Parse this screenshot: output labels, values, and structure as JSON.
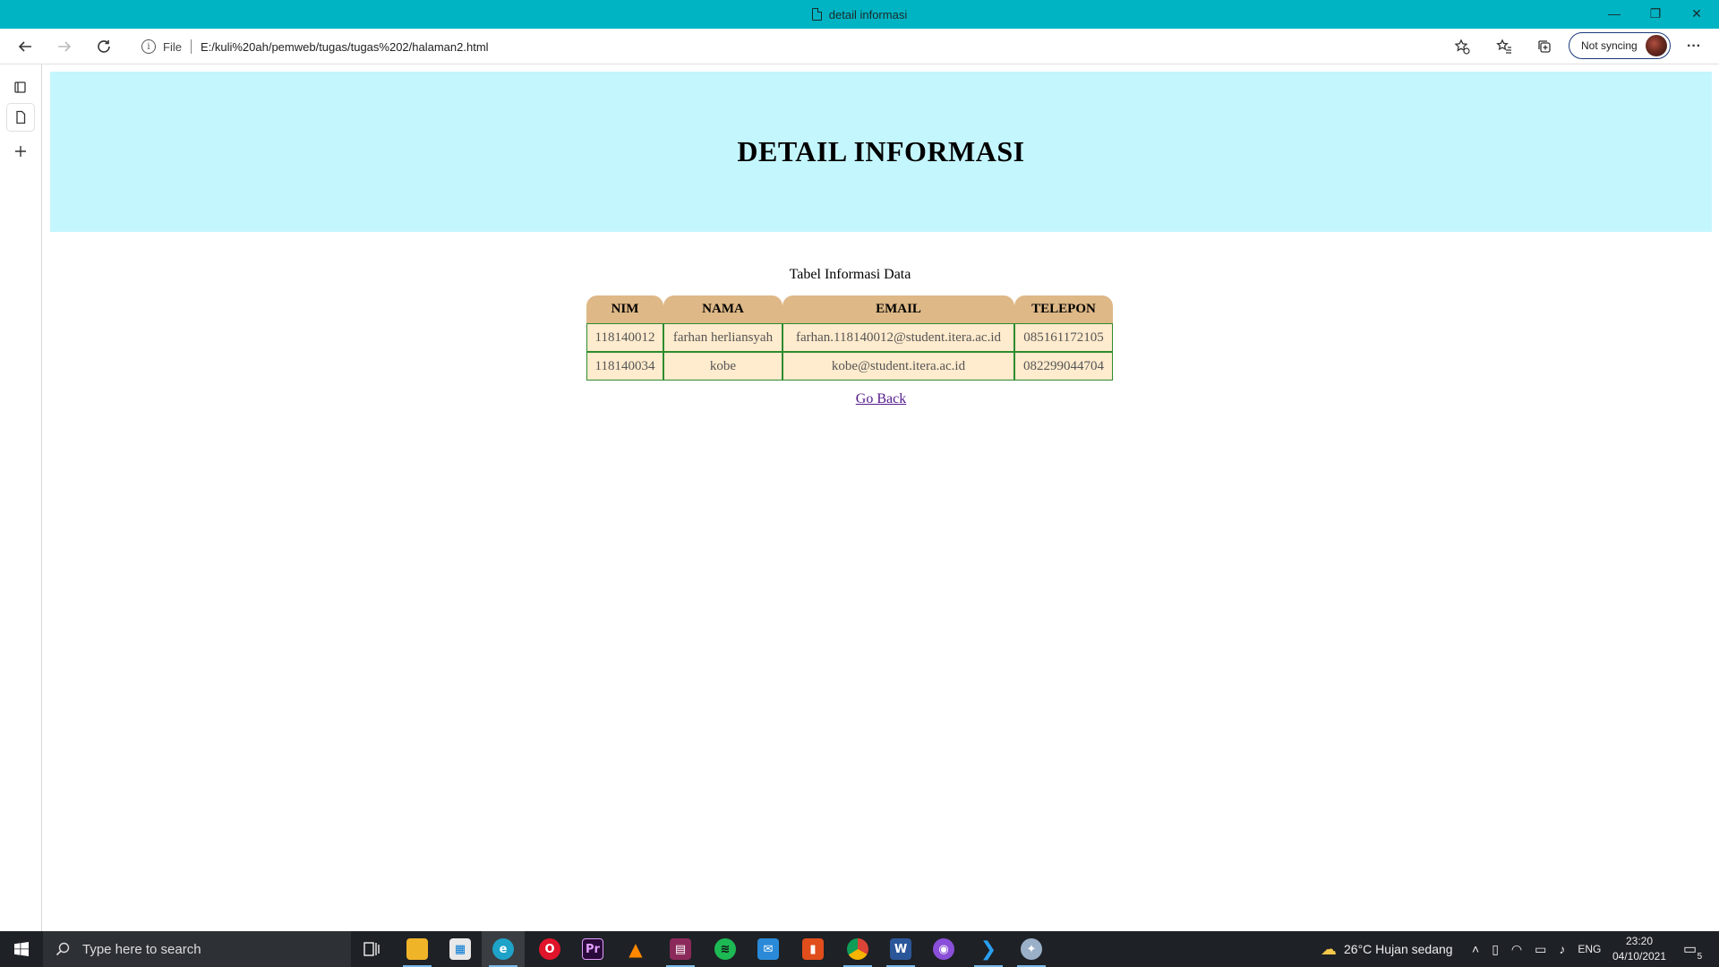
{
  "window": {
    "title": "detail informasi",
    "controls": {
      "minimize": "—",
      "restore": "❐",
      "close": "✕"
    }
  },
  "toolbar": {
    "scheme": "File",
    "url": "E:/kuli%20ah/pemweb/tugas/tugas%202/halaman2.html",
    "sync_label": "Not syncing",
    "more": "···"
  },
  "page": {
    "heading": "DETAIL INFORMASI",
    "caption": "Tabel Informasi Data",
    "table": {
      "headers": [
        "NIM",
        "NAMA",
        "EMAIL",
        "TELEPON"
      ],
      "rows": [
        [
          "118140012",
          "farhan herliansyah",
          "farhan.118140012@student.itera.ac.id",
          "085161172105"
        ],
        [
          "118140034",
          "kobe",
          "kobe@student.itera.ac.id",
          "082299044704"
        ]
      ]
    },
    "link_text": "Go Back",
    "colors": {
      "banner": "#c4f6fd",
      "header_cell": "#deb887",
      "body_cell": "#ffebcd",
      "cell_border": "#2e8b2e"
    }
  },
  "taskbar": {
    "search_placeholder": "Type here to search",
    "apps": [
      "task-view",
      "file-explorer",
      "microsoft-store",
      "edge",
      "opera",
      "premiere-pro",
      "vlc",
      "winrar",
      "spotify",
      "mail",
      "office",
      "chrome",
      "word",
      "github-desktop",
      "vscode",
      "misc-app"
    ],
    "weather": "26°C  Hujan sedang",
    "language": "ENG",
    "time": "23:20",
    "date": "04/10/2021",
    "notification_count": "5"
  }
}
